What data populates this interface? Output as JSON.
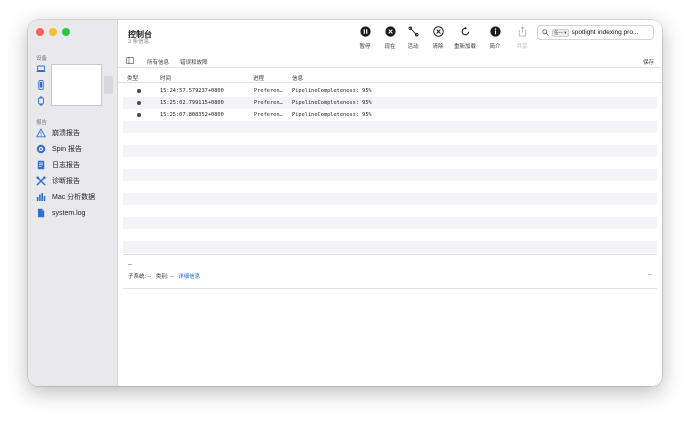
{
  "app": {
    "title": "控制台",
    "subtitle": "3 条信息"
  },
  "sidebar": {
    "devices_header": "设备",
    "reports_header": "报告",
    "reports": [
      {
        "label": "崩溃报告",
        "icon": "warning-triangle-icon"
      },
      {
        "label": "Spin 报告",
        "icon": "spin-report-icon"
      },
      {
        "label": "日志报告",
        "icon": "document-icon"
      },
      {
        "label": "诊断报告",
        "icon": "tools-icon"
      },
      {
        "label": "Mac 分析数据",
        "icon": "bar-chart-icon"
      },
      {
        "label": "system.log",
        "icon": "file-icon"
      }
    ]
  },
  "toolbar": {
    "buttons": [
      {
        "label": "暂停",
        "icon": "pause-icon"
      },
      {
        "label": "现在",
        "icon": "now-icon"
      },
      {
        "label": "活动",
        "icon": "activity-icon"
      },
      {
        "label": "清除",
        "icon": "clear-icon"
      },
      {
        "label": "重新加载",
        "icon": "reload-icon"
      },
      {
        "label": "简介",
        "icon": "info-icon"
      },
      {
        "label": "共享",
        "icon": "share-icon"
      }
    ],
    "search": {
      "scope": "任一 ▾",
      "value": "spotlight indexing pro..."
    }
  },
  "filter": {
    "all": "所有信息",
    "errors": "错误和故障",
    "save": "保存"
  },
  "table": {
    "columns": [
      "类型",
      "时间",
      "进程",
      "信息"
    ],
    "rows": [
      {
        "time": "15:24:57.579237+0800",
        "process": "Preferen…",
        "message": "PipelineCompleteness: 95%"
      },
      {
        "time": "15:25:02.799115+0800",
        "process": "Preferen…",
        "message": "PipelineCompleteness: 95%"
      },
      {
        "time": "15:25:07.808352+0800",
        "process": "Preferen…",
        "message": "PipelineCompleteness: 95%"
      }
    ]
  },
  "detail": {
    "dashes": "--",
    "subsystem": "子系统: --",
    "category": "类别: --",
    "details_link": "详细信息",
    "right": "--"
  },
  "colors": {
    "close": "#fe5f57",
    "minimize": "#febc2e",
    "maximize": "#28c840",
    "link": "#1a66cc",
    "accent": "#2f6fd6"
  }
}
